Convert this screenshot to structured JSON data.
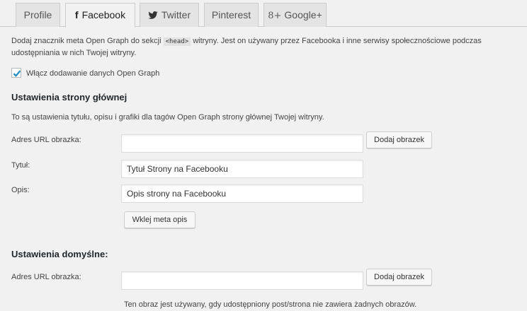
{
  "tabs": [
    {
      "label": "Profile",
      "icon": "",
      "active": false
    },
    {
      "label": "Facebook",
      "icon": "facebook-icon",
      "active": true
    },
    {
      "label": "Twitter",
      "icon": "twitter-icon",
      "active": false
    },
    {
      "label": "Pinterest",
      "icon": "",
      "active": false
    },
    {
      "label": "Google+",
      "icon": "google-plus-icon",
      "active": false
    }
  ],
  "intro": {
    "before_code": "Dodaj znacznik meta Open Graph do sekcji",
    "code": "<head>",
    "after_code": "witryny. Jest on używany przez Facebooka i inne serwisy społecznościowe podczas udostępniania w nich Twojej witryny."
  },
  "enable_checkbox": {
    "label": "Włącz dodawanie danych Open Graph",
    "checked": true
  },
  "homepage": {
    "heading": "Ustawienia strony głównej",
    "description": "To są ustawienia tytułu, opisu i grafiki dla tagów Open Graph strony głównej Twojej witryny.",
    "image_label": "Adres URL obrazka:",
    "image_value": "",
    "add_image_button": "Dodaj obrazek",
    "title_label": "Tytuł:",
    "title_value": "Tytuł Strony na Facebooku",
    "desc_label": "Opis:",
    "desc_value": "Opis strony na Facebooku",
    "paste_meta_button": "Wklej meta opis"
  },
  "defaults": {
    "heading": "Ustawienia domyślne:",
    "image_label": "Adres URL obrazka:",
    "image_value": "",
    "add_image_button": "Dodaj obrazek",
    "help": "Ten obraz jest używany, gdy udostępniony post/strona nie zawiera żadnych obrazów."
  },
  "colors": {
    "accent": "#1e8cbe",
    "background": "#f1f1f1"
  }
}
